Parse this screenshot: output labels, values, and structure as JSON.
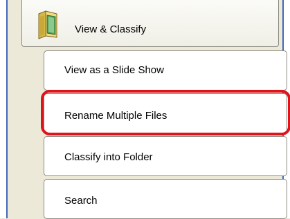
{
  "header": {
    "label": "View & Classify",
    "icon": "folder-icon"
  },
  "menu": {
    "items": [
      {
        "label": "View as a Slide Show"
      },
      {
        "label": "Rename Multiple Files"
      },
      {
        "label": "Classify into Folder"
      },
      {
        "label": "Search"
      }
    ]
  },
  "highlight": {
    "target": "Rename Multiple Files",
    "color": "#e0131a"
  },
  "colors": {
    "panel_bg": "#ece9d8",
    "frame_border": "#3f67b8",
    "button_border": "#8c8a80"
  }
}
